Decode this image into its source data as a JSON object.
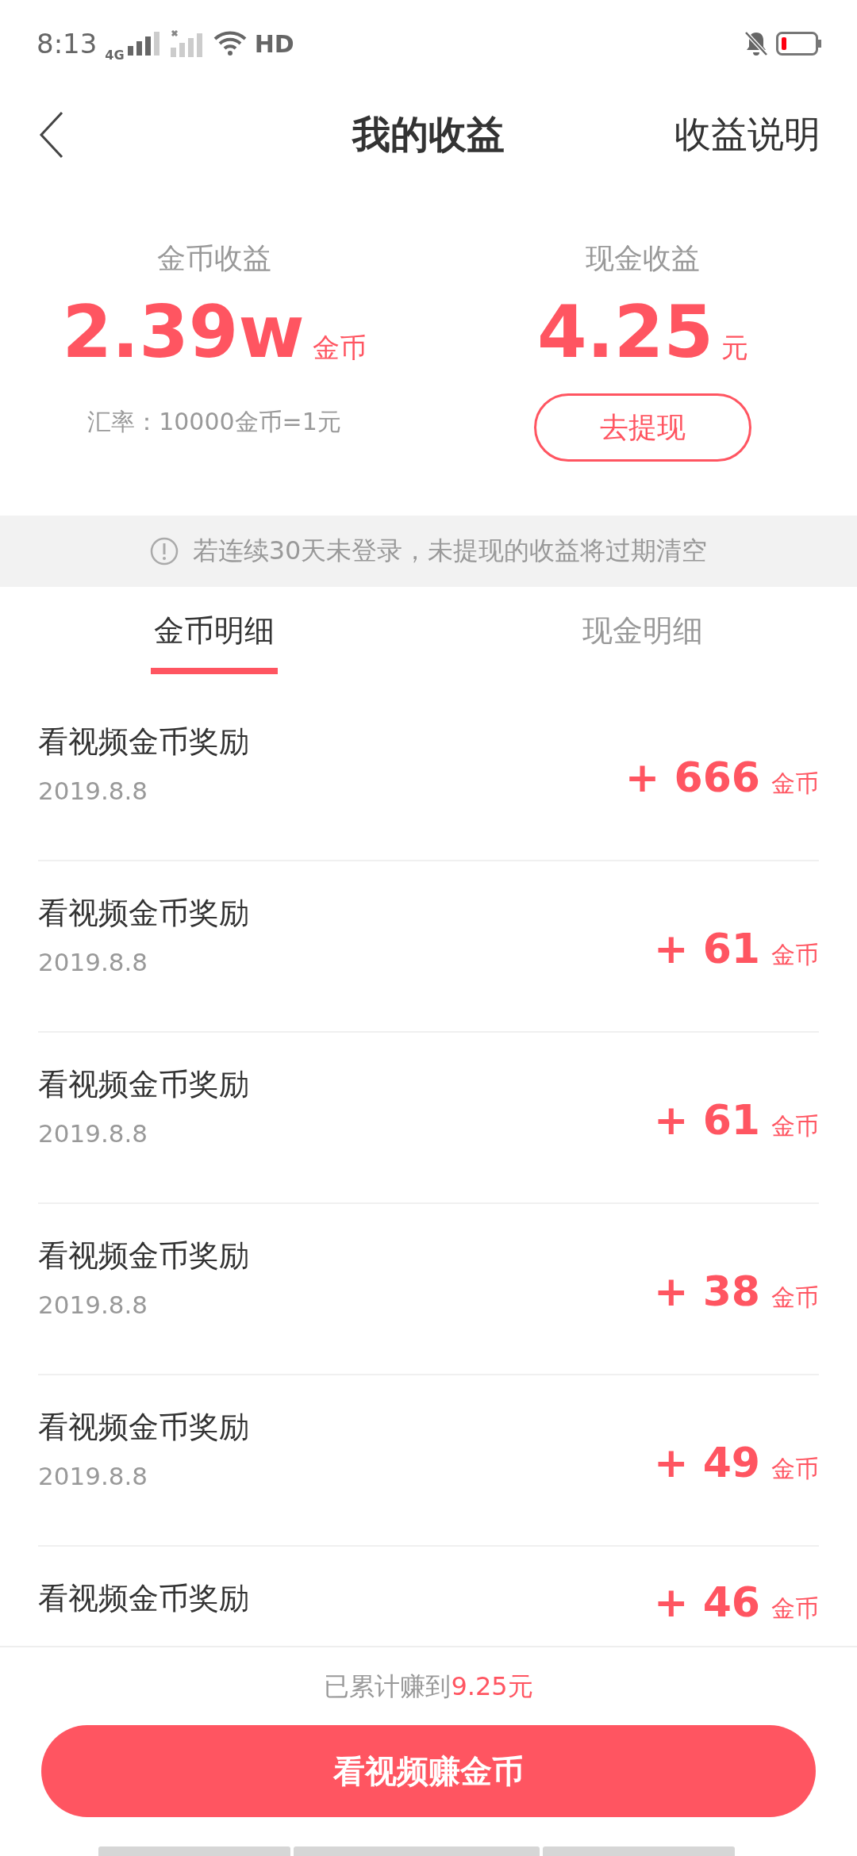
{
  "status_bar": {
    "time": "8:13",
    "network_type": "4G",
    "wifi_label": "HD"
  },
  "header": {
    "title": "我的收益",
    "action": "收益说明"
  },
  "summary": [
    {
      "label": "金币收益",
      "value": "2.39w",
      "unit": "金币",
      "note": "汇率：10000金币=1元"
    },
    {
      "label": "现金收益",
      "value": "4.25",
      "unit": "元",
      "button": "去提现"
    }
  ],
  "notice": "若连续30天未登录，未提现的收益将过期清空",
  "tabs": [
    {
      "label": "金币明细",
      "selected": true
    },
    {
      "label": "现金明细",
      "selected": false
    }
  ],
  "records": [
    {
      "title": "看视频金币奖励",
      "date": "2019.8.8",
      "amount": "+ 666",
      "unit": "金币"
    },
    {
      "title": "看视频金币奖励",
      "date": "2019.8.8",
      "amount": "+ 61",
      "unit": "金币"
    },
    {
      "title": "看视频金币奖励",
      "date": "2019.8.8",
      "amount": "+ 61",
      "unit": "金币"
    },
    {
      "title": "看视频金币奖励",
      "date": "2019.8.8",
      "amount": "+ 38",
      "unit": "金币"
    },
    {
      "title": "看视频金币奖励",
      "date": "2019.8.8",
      "amount": "+ 49",
      "unit": "金币"
    },
    {
      "title": "看视频金币奖励",
      "amount": "+ 46",
      "unit": "金币"
    }
  ],
  "footer": {
    "total_label": "已累计赚到",
    "total_value": "9.25元",
    "button": "看视频赚金币"
  }
}
